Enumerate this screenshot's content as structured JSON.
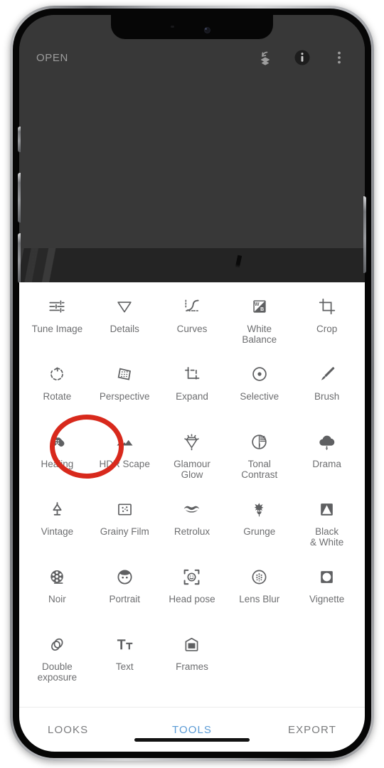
{
  "app": {
    "top_bar": {
      "open_label": "OPEN",
      "icons": [
        {
          "name": "layers-undo-icon"
        },
        {
          "name": "info-icon"
        },
        {
          "name": "overflow-menu-icon"
        }
      ]
    }
  },
  "tools": [
    {
      "label": "Tune Image",
      "icon": "tune-image-icon"
    },
    {
      "label": "Details",
      "icon": "details-icon"
    },
    {
      "label": "Curves",
      "icon": "curves-icon"
    },
    {
      "label": "White\nBalance",
      "icon": "white-balance-icon"
    },
    {
      "label": "Crop",
      "icon": "crop-icon"
    },
    {
      "label": "Rotate",
      "icon": "rotate-icon"
    },
    {
      "label": "Perspective",
      "icon": "perspective-icon"
    },
    {
      "label": "Expand",
      "icon": "expand-icon"
    },
    {
      "label": "Selective",
      "icon": "selective-icon"
    },
    {
      "label": "Brush",
      "icon": "brush-icon"
    },
    {
      "label": "Healing",
      "icon": "healing-icon"
    },
    {
      "label": "HDR Scape",
      "icon": "hdr-scape-icon"
    },
    {
      "label": "Glamour\nGlow",
      "icon": "glamour-glow-icon"
    },
    {
      "label": "Tonal\nContrast",
      "icon": "tonal-contrast-icon"
    },
    {
      "label": "Drama",
      "icon": "drama-icon"
    },
    {
      "label": "Vintage",
      "icon": "vintage-icon"
    },
    {
      "label": "Grainy Film",
      "icon": "grainy-film-icon"
    },
    {
      "label": "Retrolux",
      "icon": "retrolux-icon"
    },
    {
      "label": "Grunge",
      "icon": "grunge-icon"
    },
    {
      "label": "Black\n& White",
      "icon": "black-and-white-icon"
    },
    {
      "label": "Noir",
      "icon": "noir-icon"
    },
    {
      "label": "Portrait",
      "icon": "portrait-icon"
    },
    {
      "label": "Head pose",
      "icon": "head-pose-icon"
    },
    {
      "label": "Lens Blur",
      "icon": "lens-blur-icon"
    },
    {
      "label": "Vignette",
      "icon": "vignette-icon"
    },
    {
      "label": "Double\nexposure",
      "icon": "double-exposure-icon"
    },
    {
      "label": "Text",
      "icon": "text-icon"
    },
    {
      "label": "Frames",
      "icon": "frames-icon"
    }
  ],
  "bottom_nav": {
    "items": [
      {
        "label": "LOOKS",
        "active": false
      },
      {
        "label": "TOOLS",
        "active": true
      },
      {
        "label": "EXPORT",
        "active": false
      }
    ]
  },
  "annotation": {
    "type": "circle-highlight",
    "target": "Healing",
    "color": "#d8291c"
  },
  "colors": {
    "accent": "#5b9bd5",
    "annotation_red": "#d8291c",
    "icon_gray": "#5f6062",
    "label_gray": "#6d6e70",
    "preview_bg": "#383838",
    "sheet_bg": "#ffffff"
  }
}
